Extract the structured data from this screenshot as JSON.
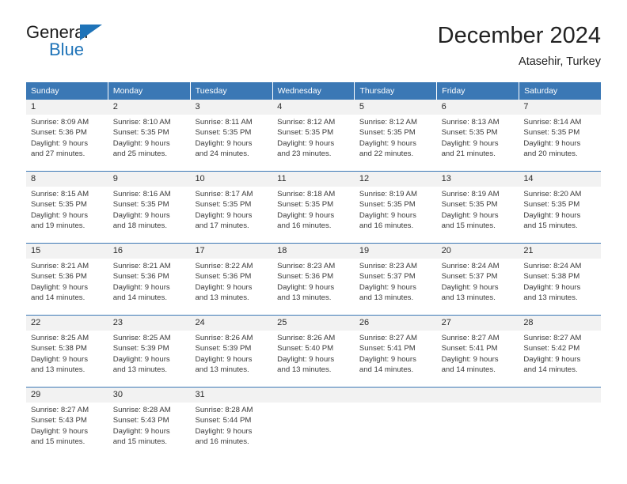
{
  "logo": {
    "primary_text": "General",
    "secondary_text": "Blue",
    "triangle_icon": "triangle-icon",
    "accent_color": "#1e73b8"
  },
  "header": {
    "title": "December 2024",
    "subtitle": "Atasehir, Turkey"
  },
  "colors": {
    "header_blue": "#3b78b5",
    "daynum_band": "#f2f2f2",
    "separator_blue": "#3b78b5",
    "text": "#3a3a3a"
  },
  "weekdays": [
    "Sunday",
    "Monday",
    "Tuesday",
    "Wednesday",
    "Thursday",
    "Friday",
    "Saturday"
  ],
  "weeks": [
    {
      "days": [
        {
          "day": "1",
          "sunrise": "Sunrise: 8:09 AM",
          "sunset": "Sunset: 5:36 PM",
          "daylight_line1": "Daylight: 9 hours",
          "daylight_line2": "and 27 minutes."
        },
        {
          "day": "2",
          "sunrise": "Sunrise: 8:10 AM",
          "sunset": "Sunset: 5:35 PM",
          "daylight_line1": "Daylight: 9 hours",
          "daylight_line2": "and 25 minutes."
        },
        {
          "day": "3",
          "sunrise": "Sunrise: 8:11 AM",
          "sunset": "Sunset: 5:35 PM",
          "daylight_line1": "Daylight: 9 hours",
          "daylight_line2": "and 24 minutes."
        },
        {
          "day": "4",
          "sunrise": "Sunrise: 8:12 AM",
          "sunset": "Sunset: 5:35 PM",
          "daylight_line1": "Daylight: 9 hours",
          "daylight_line2": "and 23 minutes."
        },
        {
          "day": "5",
          "sunrise": "Sunrise: 8:12 AM",
          "sunset": "Sunset: 5:35 PM",
          "daylight_line1": "Daylight: 9 hours",
          "daylight_line2": "and 22 minutes."
        },
        {
          "day": "6",
          "sunrise": "Sunrise: 8:13 AM",
          "sunset": "Sunset: 5:35 PM",
          "daylight_line1": "Daylight: 9 hours",
          "daylight_line2": "and 21 minutes."
        },
        {
          "day": "7",
          "sunrise": "Sunrise: 8:14 AM",
          "sunset": "Sunset: 5:35 PM",
          "daylight_line1": "Daylight: 9 hours",
          "daylight_line2": "and 20 minutes."
        }
      ]
    },
    {
      "days": [
        {
          "day": "8",
          "sunrise": "Sunrise: 8:15 AM",
          "sunset": "Sunset: 5:35 PM",
          "daylight_line1": "Daylight: 9 hours",
          "daylight_line2": "and 19 minutes."
        },
        {
          "day": "9",
          "sunrise": "Sunrise: 8:16 AM",
          "sunset": "Sunset: 5:35 PM",
          "daylight_line1": "Daylight: 9 hours",
          "daylight_line2": "and 18 minutes."
        },
        {
          "day": "10",
          "sunrise": "Sunrise: 8:17 AM",
          "sunset": "Sunset: 5:35 PM",
          "daylight_line1": "Daylight: 9 hours",
          "daylight_line2": "and 17 minutes."
        },
        {
          "day": "11",
          "sunrise": "Sunrise: 8:18 AM",
          "sunset": "Sunset: 5:35 PM",
          "daylight_line1": "Daylight: 9 hours",
          "daylight_line2": "and 16 minutes."
        },
        {
          "day": "12",
          "sunrise": "Sunrise: 8:19 AM",
          "sunset": "Sunset: 5:35 PM",
          "daylight_line1": "Daylight: 9 hours",
          "daylight_line2": "and 16 minutes."
        },
        {
          "day": "13",
          "sunrise": "Sunrise: 8:19 AM",
          "sunset": "Sunset: 5:35 PM",
          "daylight_line1": "Daylight: 9 hours",
          "daylight_line2": "and 15 minutes."
        },
        {
          "day": "14",
          "sunrise": "Sunrise: 8:20 AM",
          "sunset": "Sunset: 5:35 PM",
          "daylight_line1": "Daylight: 9 hours",
          "daylight_line2": "and 15 minutes."
        }
      ]
    },
    {
      "days": [
        {
          "day": "15",
          "sunrise": "Sunrise: 8:21 AM",
          "sunset": "Sunset: 5:36 PM",
          "daylight_line1": "Daylight: 9 hours",
          "daylight_line2": "and 14 minutes."
        },
        {
          "day": "16",
          "sunrise": "Sunrise: 8:21 AM",
          "sunset": "Sunset: 5:36 PM",
          "daylight_line1": "Daylight: 9 hours",
          "daylight_line2": "and 14 minutes."
        },
        {
          "day": "17",
          "sunrise": "Sunrise: 8:22 AM",
          "sunset": "Sunset: 5:36 PM",
          "daylight_line1": "Daylight: 9 hours",
          "daylight_line2": "and 13 minutes."
        },
        {
          "day": "18",
          "sunrise": "Sunrise: 8:23 AM",
          "sunset": "Sunset: 5:36 PM",
          "daylight_line1": "Daylight: 9 hours",
          "daylight_line2": "and 13 minutes."
        },
        {
          "day": "19",
          "sunrise": "Sunrise: 8:23 AM",
          "sunset": "Sunset: 5:37 PM",
          "daylight_line1": "Daylight: 9 hours",
          "daylight_line2": "and 13 minutes."
        },
        {
          "day": "20",
          "sunrise": "Sunrise: 8:24 AM",
          "sunset": "Sunset: 5:37 PM",
          "daylight_line1": "Daylight: 9 hours",
          "daylight_line2": "and 13 minutes."
        },
        {
          "day": "21",
          "sunrise": "Sunrise: 8:24 AM",
          "sunset": "Sunset: 5:38 PM",
          "daylight_line1": "Daylight: 9 hours",
          "daylight_line2": "and 13 minutes."
        }
      ]
    },
    {
      "days": [
        {
          "day": "22",
          "sunrise": "Sunrise: 8:25 AM",
          "sunset": "Sunset: 5:38 PM",
          "daylight_line1": "Daylight: 9 hours",
          "daylight_line2": "and 13 minutes."
        },
        {
          "day": "23",
          "sunrise": "Sunrise: 8:25 AM",
          "sunset": "Sunset: 5:39 PM",
          "daylight_line1": "Daylight: 9 hours",
          "daylight_line2": "and 13 minutes."
        },
        {
          "day": "24",
          "sunrise": "Sunrise: 8:26 AM",
          "sunset": "Sunset: 5:39 PM",
          "daylight_line1": "Daylight: 9 hours",
          "daylight_line2": "and 13 minutes."
        },
        {
          "day": "25",
          "sunrise": "Sunrise: 8:26 AM",
          "sunset": "Sunset: 5:40 PM",
          "daylight_line1": "Daylight: 9 hours",
          "daylight_line2": "and 13 minutes."
        },
        {
          "day": "26",
          "sunrise": "Sunrise: 8:27 AM",
          "sunset": "Sunset: 5:41 PM",
          "daylight_line1": "Daylight: 9 hours",
          "daylight_line2": "and 14 minutes."
        },
        {
          "day": "27",
          "sunrise": "Sunrise: 8:27 AM",
          "sunset": "Sunset: 5:41 PM",
          "daylight_line1": "Daylight: 9 hours",
          "daylight_line2": "and 14 minutes."
        },
        {
          "day": "28",
          "sunrise": "Sunrise: 8:27 AM",
          "sunset": "Sunset: 5:42 PM",
          "daylight_line1": "Daylight: 9 hours",
          "daylight_line2": "and 14 minutes."
        }
      ]
    },
    {
      "days": [
        {
          "day": "29",
          "sunrise": "Sunrise: 8:27 AM",
          "sunset": "Sunset: 5:43 PM",
          "daylight_line1": "Daylight: 9 hours",
          "daylight_line2": "and 15 minutes."
        },
        {
          "day": "30",
          "sunrise": "Sunrise: 8:28 AM",
          "sunset": "Sunset: 5:43 PM",
          "daylight_line1": "Daylight: 9 hours",
          "daylight_line2": "and 15 minutes."
        },
        {
          "day": "31",
          "sunrise": "Sunrise: 8:28 AM",
          "sunset": "Sunset: 5:44 PM",
          "daylight_line1": "Daylight: 9 hours",
          "daylight_line2": "and 16 minutes."
        },
        {
          "day": "",
          "sunrise": "",
          "sunset": "",
          "daylight_line1": "",
          "daylight_line2": ""
        },
        {
          "day": "",
          "sunrise": "",
          "sunset": "",
          "daylight_line1": "",
          "daylight_line2": ""
        },
        {
          "day": "",
          "sunrise": "",
          "sunset": "",
          "daylight_line1": "",
          "daylight_line2": ""
        },
        {
          "day": "",
          "sunrise": "",
          "sunset": "",
          "daylight_line1": "",
          "daylight_line2": ""
        }
      ]
    }
  ]
}
